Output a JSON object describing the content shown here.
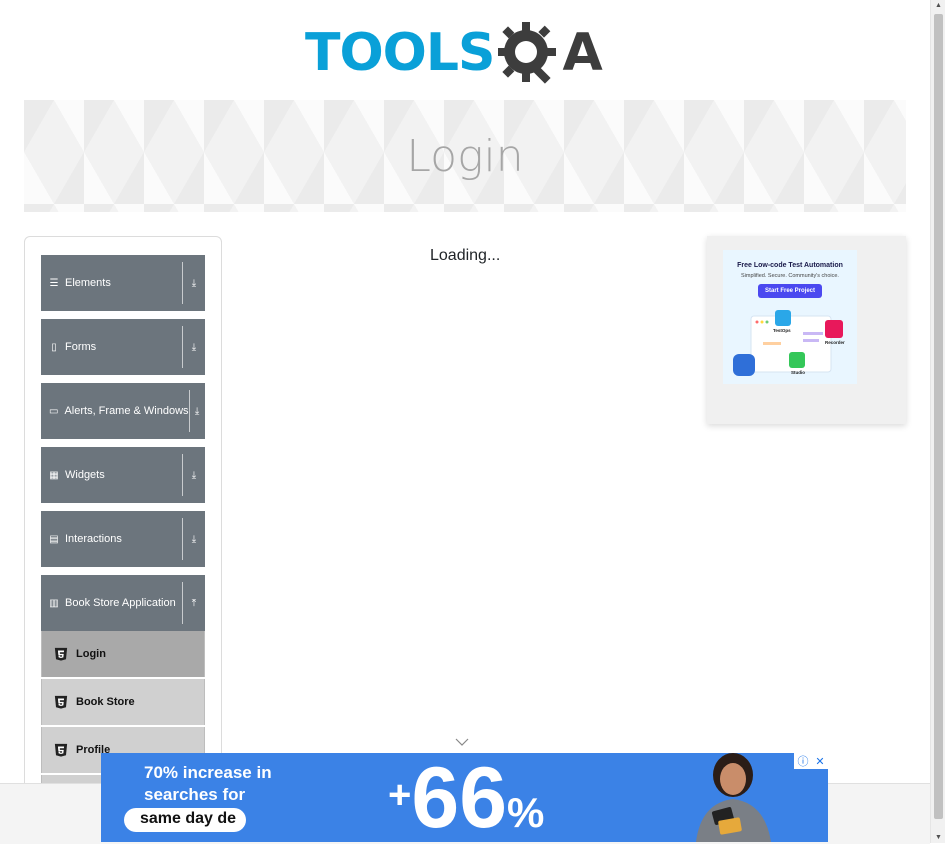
{
  "header": {
    "logo_text": "TOOLS",
    "logo_suffix": "A"
  },
  "banner": {
    "title": "Login"
  },
  "sidebar": {
    "groups": [
      {
        "label": "Elements",
        "icon": "menu-icon",
        "expanded": false
      },
      {
        "label": "Forms",
        "icon": "form-icon",
        "expanded": false
      },
      {
        "label": "Alerts, Frame & Windows",
        "icon": "window-icon",
        "expanded": false
      },
      {
        "label": "Widgets",
        "icon": "grid-icon",
        "expanded": false
      },
      {
        "label": "Interactions",
        "icon": "interaction-icon",
        "expanded": false
      },
      {
        "label": "Book Store Application",
        "icon": "chart-icon",
        "expanded": true
      }
    ],
    "book_store_items": [
      {
        "label": "Login",
        "active": true
      },
      {
        "label": "Book Store",
        "active": false
      },
      {
        "label": "Profile",
        "active": false
      }
    ]
  },
  "main": {
    "status": "Loading..."
  },
  "side_ad": {
    "heading": "Free Low-code Test Automation",
    "subheading": "Simplified. Secure. Community's choice.",
    "button": "Start Free Project",
    "labels": [
      "TestOps",
      "Recorder",
      "Studio"
    ]
  },
  "bottom_ad": {
    "line1": "70% increase in",
    "line2": "searches for",
    "pill_text": "same day de",
    "plus": "+",
    "number": "66",
    "percent": "%"
  },
  "colors": {
    "sidebar_group_bg": "#6c757d",
    "subitem_bg": "#d0d0d0",
    "subitem_active_bg": "#a9a9a9",
    "logo_blue": "#0aa0d8",
    "ad_blue": "#3b82e6"
  }
}
